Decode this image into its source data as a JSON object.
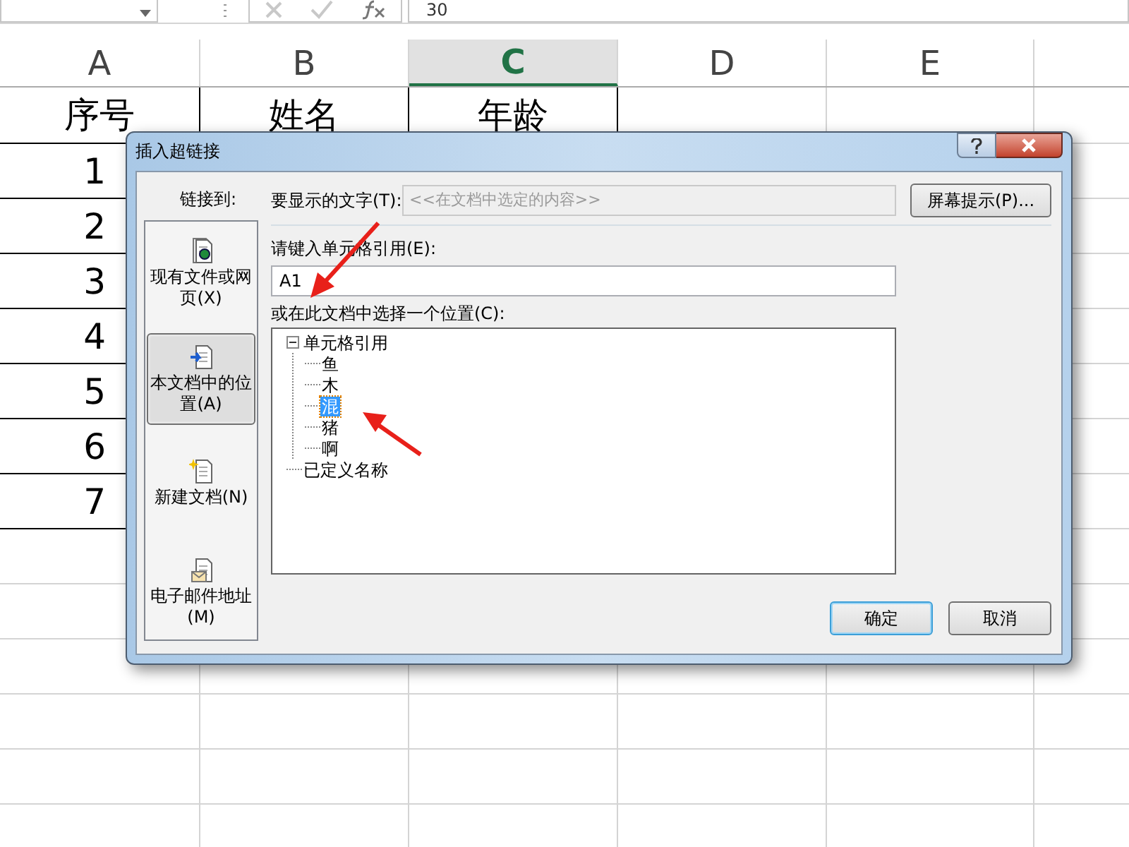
{
  "formula_bar": {
    "value": "30"
  },
  "columns": [
    {
      "label": "A",
      "selected": false
    },
    {
      "label": "B",
      "selected": false
    },
    {
      "label": "C",
      "selected": true
    },
    {
      "label": "D",
      "selected": false
    },
    {
      "label": "E",
      "selected": false
    }
  ],
  "rows": [
    [
      "序号",
      "姓名",
      "年龄"
    ],
    [
      "1"
    ],
    [
      "2"
    ],
    [
      "3"
    ],
    [
      "4"
    ],
    [
      "5"
    ],
    [
      "6"
    ],
    [
      "7"
    ]
  ],
  "dialog": {
    "title": "插入超链接",
    "link_to_label": "链接到:",
    "link_targets": [
      {
        "kind": "file",
        "label": "现有文件或网页(X)",
        "selected": false
      },
      {
        "kind": "place",
        "label": "本文档中的位置(A)",
        "selected": true
      },
      {
        "kind": "new",
        "label": "新建文档(N)",
        "selected": false
      },
      {
        "kind": "email",
        "label": "电子邮件地址(M)",
        "selected": false
      }
    ],
    "display_text": {
      "label": "要显示的文字(T):",
      "value": "<<在文档中选定的内容>>",
      "disabled": true
    },
    "screen_tip_button": "屏幕提示(P)...",
    "cell_reference": {
      "label": "请键入单元格引用(E):",
      "value": "A1"
    },
    "location_label": "或在此文档中选择一个位置(C):",
    "location_tree": [
      {
        "label": "单元格引用",
        "expanded": true,
        "selected": false,
        "children": [
          {
            "label": "鱼",
            "selected": false
          },
          {
            "label": "木",
            "selected": false
          },
          {
            "label": "混",
            "selected": true
          },
          {
            "label": "猪",
            "selected": false
          },
          {
            "label": "啊",
            "selected": false
          }
        ]
      },
      {
        "label": "已定义名称",
        "selected": false
      }
    ],
    "buttons": [
      {
        "label": "确定",
        "default": true
      },
      {
        "label": "取消",
        "default": false
      }
    ]
  }
}
